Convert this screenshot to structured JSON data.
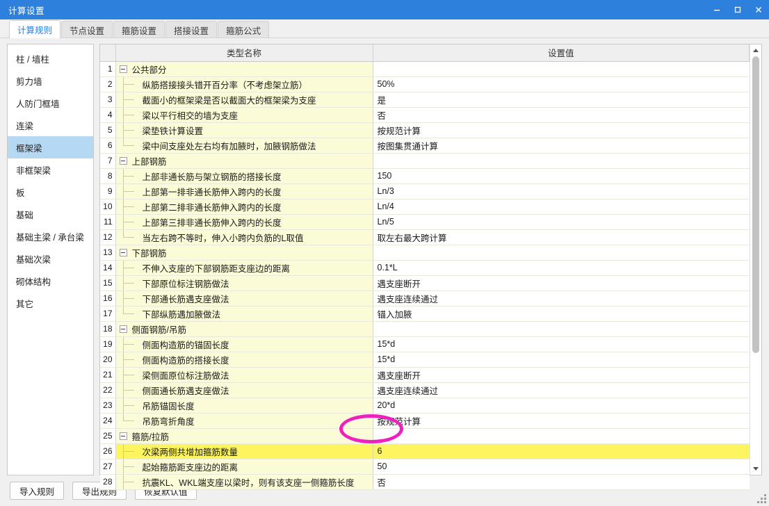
{
  "window": {
    "title": "计算设置",
    "controls": [
      {
        "name": "minimize",
        "glyph": "–"
      },
      {
        "name": "maximize",
        "glyph": "□"
      },
      {
        "name": "close",
        "glyph": "✕"
      }
    ]
  },
  "tabs": [
    {
      "label": "计算规则",
      "active": true
    },
    {
      "label": "节点设置",
      "active": false
    },
    {
      "label": "箍筋设置",
      "active": false
    },
    {
      "label": "搭接设置",
      "active": false
    },
    {
      "label": "箍筋公式",
      "active": false
    }
  ],
  "sidebar": {
    "items": [
      {
        "label": "柱 / 墙柱",
        "selected": false
      },
      {
        "label": "剪力墙",
        "selected": false
      },
      {
        "label": "人防门框墙",
        "selected": false
      },
      {
        "label": "连梁",
        "selected": false
      },
      {
        "label": "框架梁",
        "selected": true
      },
      {
        "label": "非框架梁",
        "selected": false
      },
      {
        "label": "板",
        "selected": false
      },
      {
        "label": "基础",
        "selected": false
      },
      {
        "label": "基础主梁 / 承台梁",
        "selected": false
      },
      {
        "label": "基础次梁",
        "selected": false
      },
      {
        "label": "砌体结构",
        "selected": false
      },
      {
        "label": "其它",
        "selected": false
      }
    ]
  },
  "grid": {
    "columns": [
      "",
      "类型名称",
      "设置值"
    ],
    "rows": [
      {
        "n": "1",
        "type": "group",
        "name": "公共部分",
        "value": ""
      },
      {
        "n": "2",
        "type": "child",
        "name": "纵筋搭接接头错开百分率（不考虑架立筋）",
        "value": "50%"
      },
      {
        "n": "3",
        "type": "child",
        "name": "截面小的框架梁是否以截面大的框架梁为支座",
        "value": "是"
      },
      {
        "n": "4",
        "type": "child",
        "name": "梁以平行相交的墙为支座",
        "value": "否"
      },
      {
        "n": "5",
        "type": "child",
        "name": "梁垫铁计算设置",
        "value": "按规范计算"
      },
      {
        "n": "6",
        "type": "last",
        "name": "梁中间支座处左右均有加腋时，加腋钢筋做法",
        "value": "按图集贯通计算"
      },
      {
        "n": "7",
        "type": "group",
        "name": "上部钢筋",
        "value": ""
      },
      {
        "n": "8",
        "type": "child",
        "name": "上部非通长筋与架立钢筋的搭接长度",
        "value": "150"
      },
      {
        "n": "9",
        "type": "child",
        "name": "上部第一排非通长筋伸入跨内的长度",
        "value": "Ln/3"
      },
      {
        "n": "10",
        "type": "child",
        "name": "上部第二排非通长筋伸入跨内的长度",
        "value": "Ln/4"
      },
      {
        "n": "11",
        "type": "child",
        "name": "上部第三排非通长筋伸入跨内的长度",
        "value": "Ln/5"
      },
      {
        "n": "12",
        "type": "last",
        "name": "当左右跨不等时，伸入小跨内负筋的L取值",
        "value": "取左右最大跨计算"
      },
      {
        "n": "13",
        "type": "group",
        "name": "下部钢筋",
        "value": ""
      },
      {
        "n": "14",
        "type": "child",
        "name": "不伸入支座的下部钢筋距支座边的距离",
        "value": "0.1*L"
      },
      {
        "n": "15",
        "type": "child",
        "name": "下部原位标注钢筋做法",
        "value": "遇支座断开"
      },
      {
        "n": "16",
        "type": "child",
        "name": "下部通长筋遇支座做法",
        "value": "遇支座连续通过"
      },
      {
        "n": "17",
        "type": "last",
        "name": "下部纵筋遇加腋做法",
        "value": "锚入加腋"
      },
      {
        "n": "18",
        "type": "group",
        "name": "侧面钢筋/吊筋",
        "value": ""
      },
      {
        "n": "19",
        "type": "child",
        "name": "侧面构造筋的锚固长度",
        "value": "15*d"
      },
      {
        "n": "20",
        "type": "child",
        "name": "侧面构造筋的搭接长度",
        "value": "15*d"
      },
      {
        "n": "21",
        "type": "child",
        "name": "梁侧面原位标注筋做法",
        "value": "遇支座断开"
      },
      {
        "n": "22",
        "type": "child",
        "name": "侧面通长筋遇支座做法",
        "value": "遇支座连续通过"
      },
      {
        "n": "23",
        "type": "child",
        "name": "吊筋锚固长度",
        "value": "20*d"
      },
      {
        "n": "24",
        "type": "last",
        "name": "吊筋弯折角度",
        "value": "按规范计算"
      },
      {
        "n": "25",
        "type": "group",
        "name": "箍筋/拉筋",
        "value": ""
      },
      {
        "n": "26",
        "type": "child",
        "name": "次梁两侧共增加箍筋数量",
        "value": "6",
        "selected": true
      },
      {
        "n": "27",
        "type": "child",
        "name": "起始箍筋距支座边的距离",
        "value": "50"
      },
      {
        "n": "28",
        "type": "child",
        "name": "抗震KL、WKL端支座以梁时，则有该支座一侧箍筋长度",
        "value": "否"
      }
    ]
  },
  "footer": {
    "buttons": [
      {
        "label": "导入规则",
        "name": "import-rules-button"
      },
      {
        "label": "导出规则",
        "name": "export-rules-button"
      },
      {
        "label": "恢复默认值",
        "name": "restore-defaults-button"
      }
    ]
  },
  "annotation": {
    "shape": "ellipse",
    "color": "#f01fc0",
    "targets_row": "26",
    "targets_value": "6"
  }
}
